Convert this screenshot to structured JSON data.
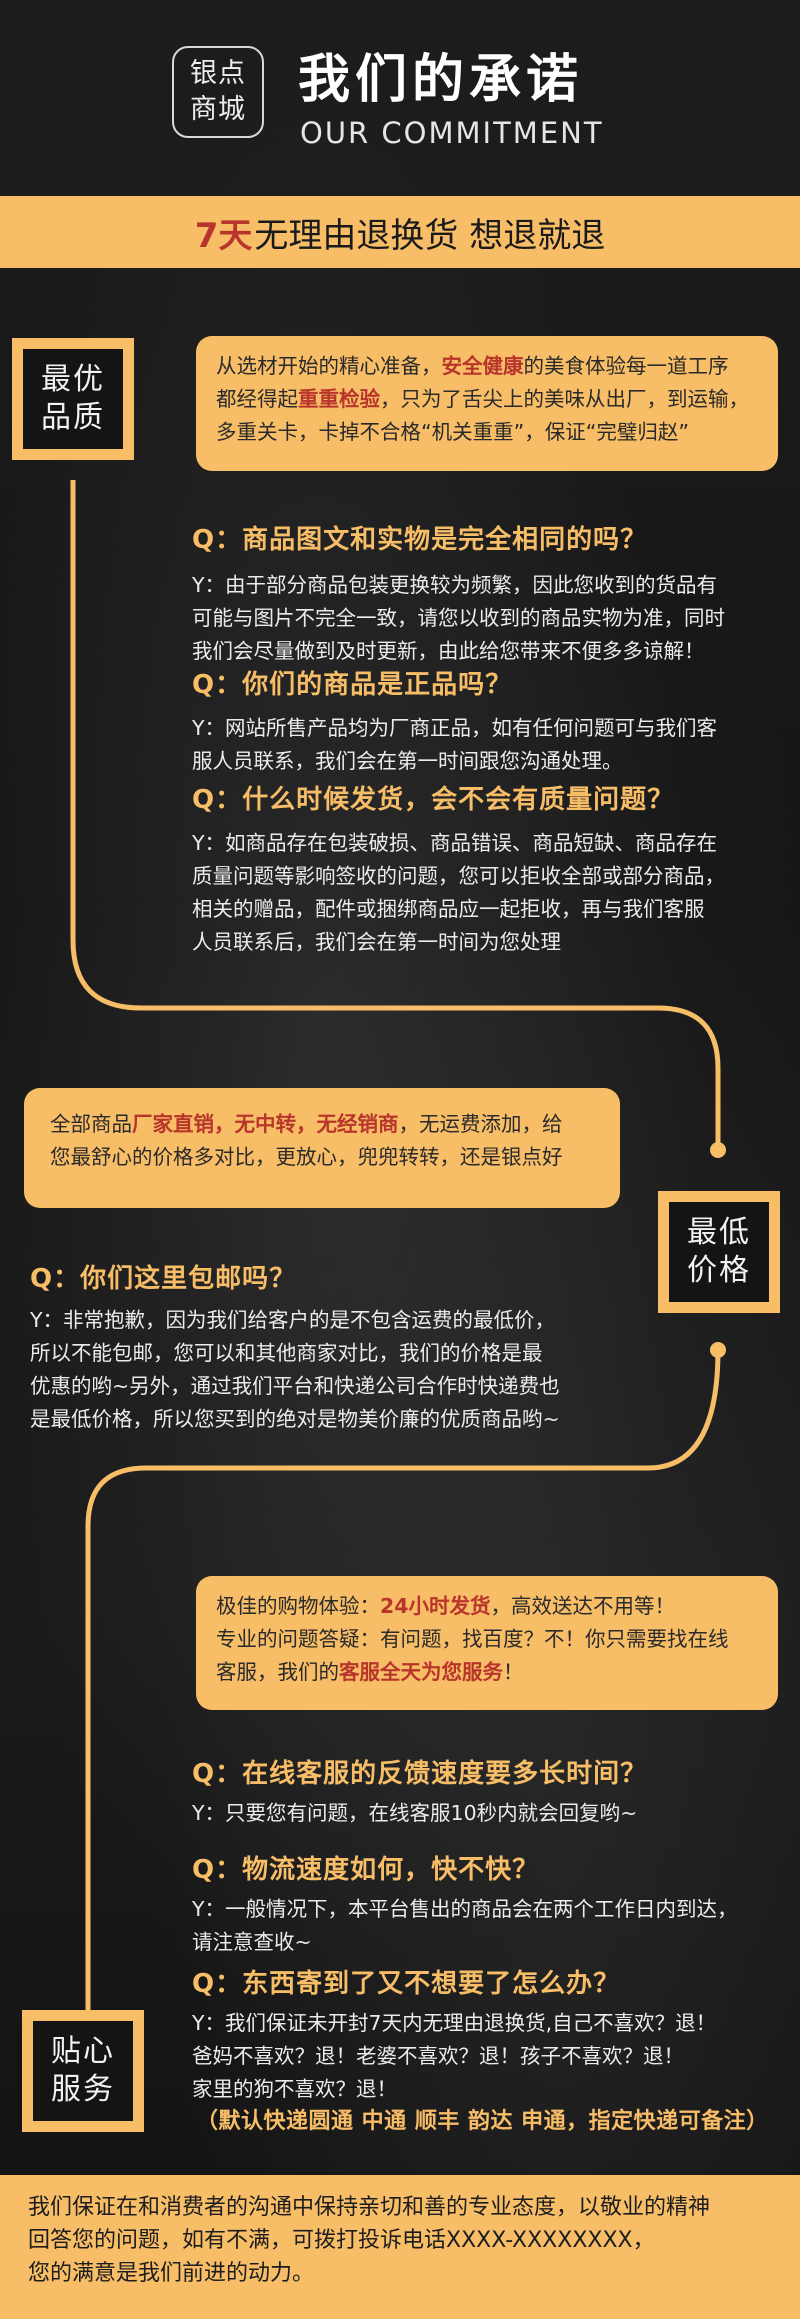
{
  "header": {
    "logo_line1": "银点",
    "logo_line2": "商城",
    "title_cn": "我们的承诺",
    "title_en": "OUR COMMITMENT"
  },
  "banner": {
    "highlight": "7天",
    "text": "无理由退换货 想退就退"
  },
  "colors": {
    "accent": "#f7bd67",
    "highlight_red": "#b8352b",
    "background": "#161616"
  },
  "sections": [
    {
      "badge": [
        "最优",
        "品质"
      ],
      "intro": {
        "p1": "从选材开始的精心准备，",
        "r1": "安全健康",
        "p2": "的美食体验每一道工序",
        "p3": "都经得起",
        "r2": "重重检验",
        "p4": "，只为了舌尖上的美味从出厂，到运输，",
        "p5": "多重关卡，卡掉不合格“机关重重”，保证“完璧归赵”"
      },
      "qa": [
        {
          "q": "Q：商品图文和实物是完全相同的吗？",
          "a": [
            "Y：由于部分商品包装更换较为频繁，因此您收到的货品有",
            "可能与图片不完全一致，请您以收到的商品实物为准，同时",
            "我们会尽量做到及时更新，由此给您带来不便多多谅解！"
          ]
        },
        {
          "q": "Q：你们的商品是正品吗？",
          "a": [
            "Y：网站所售产品均为厂商正品，如有任何问题可与我们客",
            "服人员联系，我们会在第一时间跟您沟通处理。"
          ]
        },
        {
          "q": "Q：什么时候发货，会不会有质量问题？",
          "a": [
            "Y：如商品存在包装破损、商品错误、商品短缺、商品存在",
            "质量问题等影响签收的问题，您可以拒收全部或部分商品，",
            "相关的赠品，配件或捆绑商品应一起拒收，再与我们客服",
            "人员联系后，我们会在第一时间为您处理"
          ]
        }
      ]
    },
    {
      "badge": [
        "最低",
        "价格"
      ],
      "intro": {
        "p1": "全部商品",
        "r1": "厂家直销，无中转，无经销商",
        "p2": "，无运费添加，给",
        "p3": "您最舒心的价格多对比，更放心，兜兜转转，还是银点好"
      },
      "qa": [
        {
          "q": "Q：你们这里包邮吗？",
          "a": [
            "Y：非常抱歉，因为我们给客户的是不包含运费的最低价，",
            "所以不能包邮，您可以和其他商家对比，我们的价格是最",
            "优惠的哟~另外，通过我们平台和快递公司合作时快递费也",
            "是最低价格，所以您买到的绝对是物美价廉的优质商品哟~"
          ]
        }
      ]
    },
    {
      "badge": [
        "贴心",
        "服务"
      ],
      "intro": {
        "p1": "极佳的购物体验：",
        "r1": "24小时发货",
        "p2": "，高效送达不用等！",
        "p3": "专业的问题答疑：有问题，找百度？不！你只需要找在线",
        "p4": "客服，我们的",
        "r2": "客服全天为您服务",
        "p5": "！"
      },
      "qa": [
        {
          "q": "Q：在线客服的反馈速度要多长时间？",
          "a": [
            "Y：只要您有问题，在线客服10秒内就会回复哟~"
          ]
        },
        {
          "q": "Q：物流速度如何，快不快？",
          "a": [
            "Y：一般情况下，本平台售出的商品会在两个工作日内到达，",
            "请注意查收~"
          ]
        },
        {
          "q": "Q：东西寄到了又不想要了怎么办？",
          "a": [
            "Y：我们保证未开封7天内无理由退换货,自己不喜欢？退！",
            "爸妈不喜欢？退！老婆不喜欢？退！孩子不喜欢？退！",
            "家里的狗不喜欢？退！"
          ]
        }
      ],
      "note": "（默认快递圆通 中通 顺丰 韵达 申通，指定快递可备注）"
    }
  ],
  "footer": {
    "lines": [
      "我们保证在和消费者的沟通中保持亲切和善的专业态度，以敬业的精神",
      "回答您的问题，如有不满，可拨打投诉电话XXXX-XXXXXXXX，",
      "您的满意是我们前进的动力。"
    ]
  }
}
